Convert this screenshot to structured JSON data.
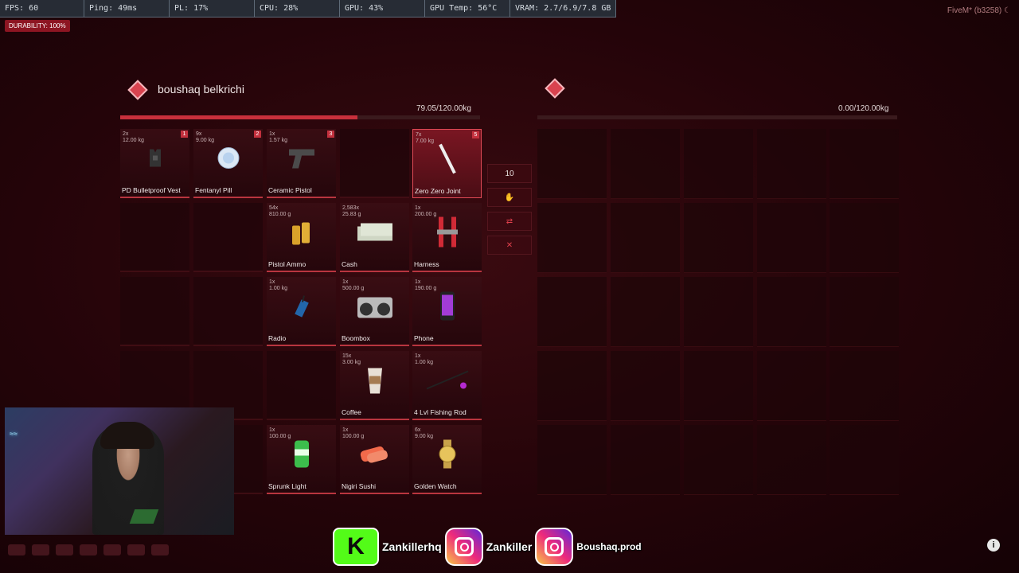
{
  "perf": {
    "fps": "FPS: 60",
    "ping": "Ping: 49ms",
    "pl": "PL: 17%",
    "cpu": "CPU: 28%",
    "gpu": "GPU: 43%",
    "gputemp": "GPU Temp: 56°C",
    "vram": "VRAM: 2.7/6.9/7.8 GB"
  },
  "durability": "DURABILITY: 100%",
  "fivem": "FiveM* (b3258)",
  "player": {
    "name": "boushaq belkrichi",
    "weight": "79.05/120.00kg",
    "weight_fraction": 0.66
  },
  "secondary": {
    "weight": "0.00/120.00kg",
    "weight_fraction": 0
  },
  "amount_value": "10",
  "inventory": [
    {
      "name": "PD Bulletproof Vest",
      "count": "2x",
      "weight": "12.00 kg",
      "badge": "1",
      "icon": "vest-icon"
    },
    {
      "name": "Fentanyl Pill",
      "count": "9x",
      "weight": "9.00 kg",
      "badge": "2",
      "icon": "pill-icon"
    },
    {
      "name": "Ceramic Pistol",
      "count": "1x",
      "weight": "1.57 kg",
      "badge": "3",
      "icon": "pistol-icon"
    },
    {
      "name": "",
      "count": "",
      "weight": "",
      "badge": "",
      "icon": ""
    },
    {
      "name": "Zero Zero Joint",
      "count": "7x",
      "weight": "7.00 kg",
      "badge": "5",
      "icon": "joint-icon",
      "selected": true
    },
    {
      "name": "",
      "icon": ""
    },
    {
      "name": "",
      "icon": ""
    },
    {
      "name": "Pistol Ammo",
      "count": "54x",
      "weight": "810.00 g",
      "icon": "ammo-icon"
    },
    {
      "name": "Cash",
      "count": "2,583x",
      "weight": "25.83 g",
      "icon": "cash-icon"
    },
    {
      "name": "Harness",
      "count": "1x",
      "weight": "200.00 g",
      "icon": "harness-icon"
    },
    {
      "name": "",
      "icon": ""
    },
    {
      "name": "",
      "icon": ""
    },
    {
      "name": "Radio",
      "count": "1x",
      "weight": "1.00 kg",
      "icon": "radio-icon"
    },
    {
      "name": "Boombox",
      "count": "1x",
      "weight": "500.00 g",
      "icon": "boombox-icon"
    },
    {
      "name": "Phone",
      "count": "1x",
      "weight": "190.00 g",
      "icon": "phone-icon"
    },
    {
      "name": "",
      "icon": ""
    },
    {
      "name": "",
      "icon": ""
    },
    {
      "name": "",
      "icon": ""
    },
    {
      "name": "Coffee",
      "count": "15x",
      "weight": "3.00 kg",
      "icon": "coffee-icon"
    },
    {
      "name": "4 Lvl Fishing Rod",
      "count": "1x",
      "weight": "1.00 kg",
      "icon": "fishing-rod-icon"
    },
    {
      "name": "",
      "icon": ""
    },
    {
      "name": "",
      "icon": ""
    },
    {
      "name": "Sprunk Light",
      "count": "1x",
      "weight": "100.00 g",
      "icon": "soda-can-icon"
    },
    {
      "name": "Nigiri Sushi",
      "count": "1x",
      "weight": "100.00 g",
      "icon": "sushi-icon"
    },
    {
      "name": "Golden Watch",
      "count": "6x",
      "weight": "9.00 kg",
      "icon": "watch-icon"
    }
  ],
  "socials": {
    "kick": "Zankillerhq",
    "ig1": "Zankiller",
    "ig2": "Boushaq.prod"
  }
}
